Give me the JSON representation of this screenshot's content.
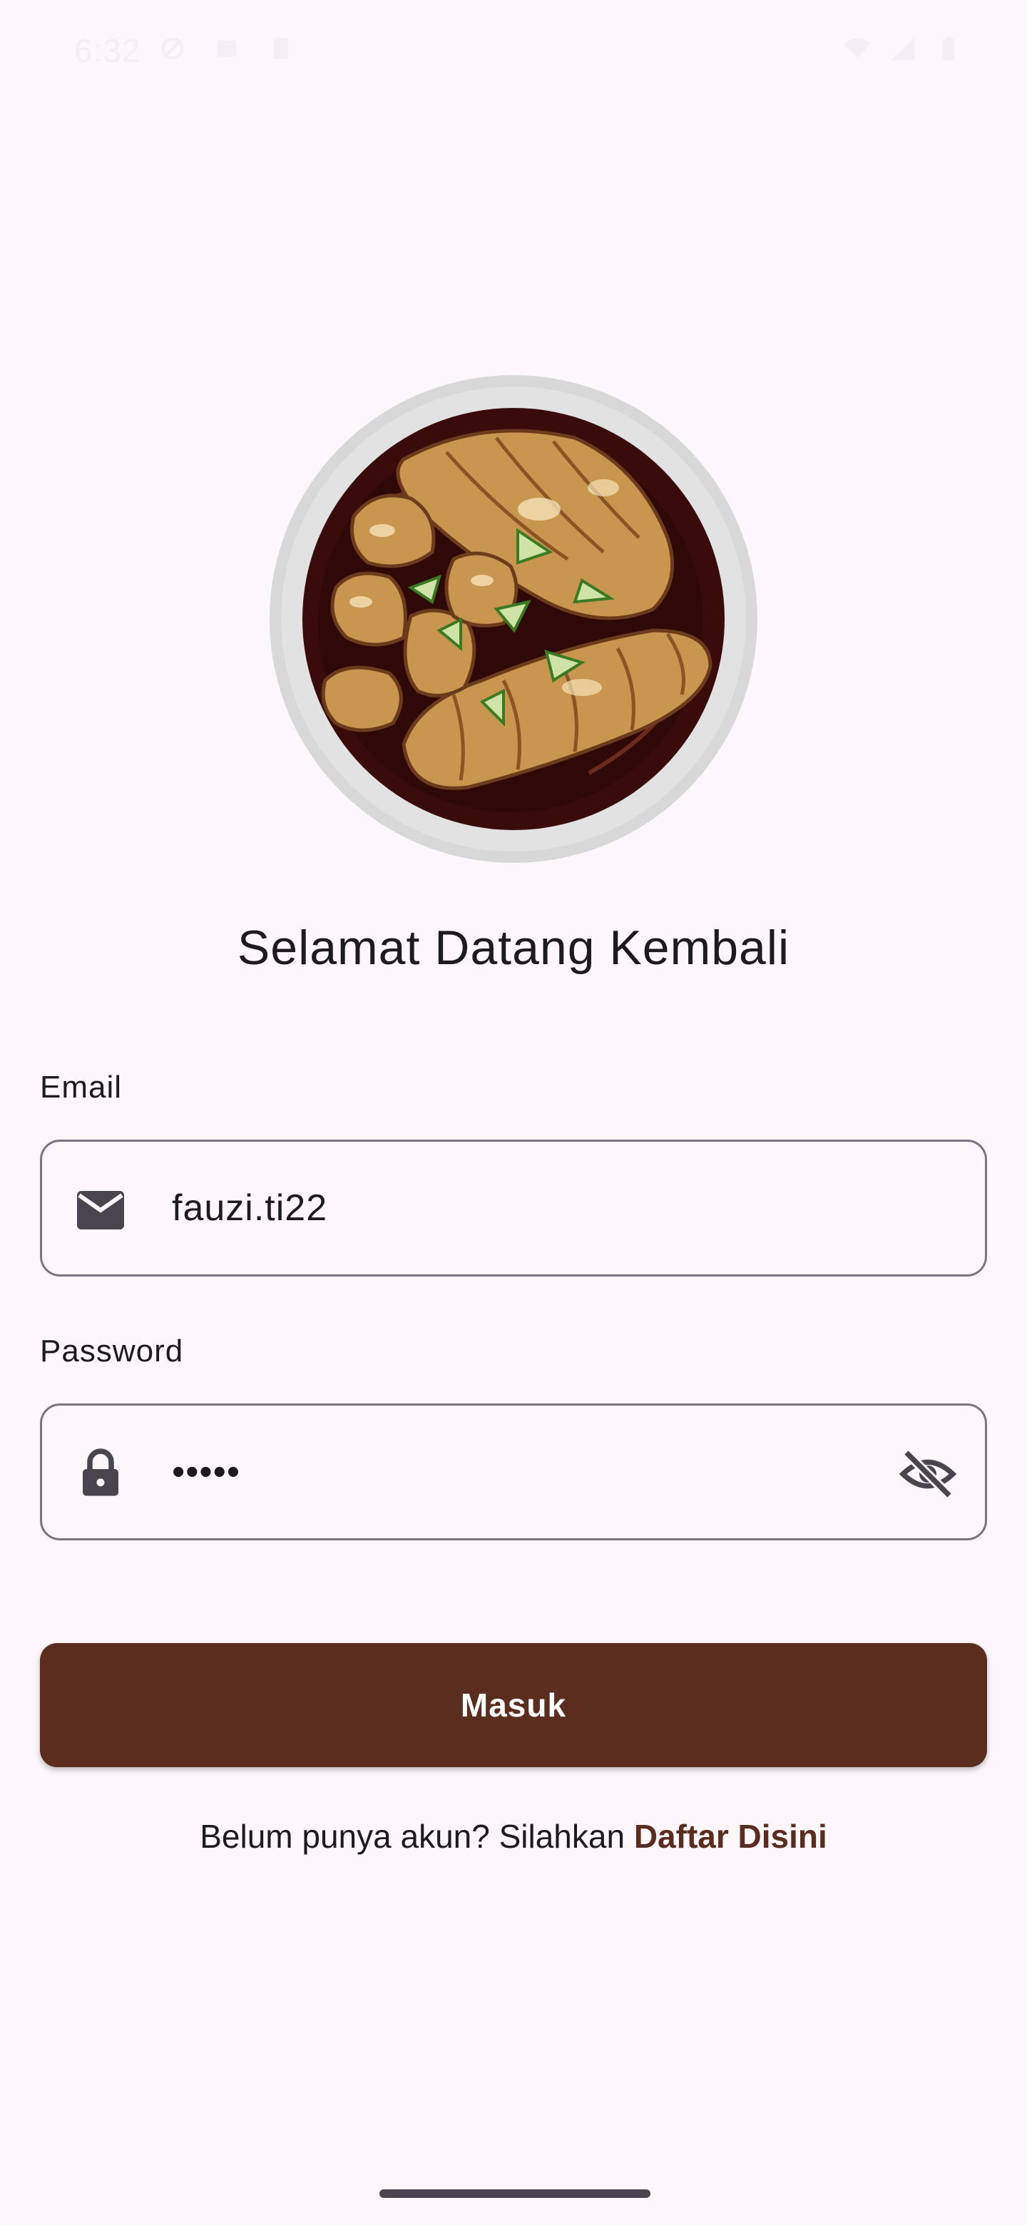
{
  "status_bar": {
    "time": "6:32",
    "icons_left": [
      "data-saver-icon",
      "notification-icon",
      "sd-card-icon"
    ],
    "icons_right": [
      "wifi-icon",
      "signal-icon",
      "battery-icon"
    ]
  },
  "hero": {
    "image": "bakso-bowl-illustration"
  },
  "welcome_title": "Selamat Datang Kembali",
  "form": {
    "email": {
      "label": "Email",
      "value": "fauzi.ti22",
      "icon": "mail-icon"
    },
    "password": {
      "label": "Password",
      "value": "•••••",
      "icon": "lock-icon",
      "toggle_icon": "visibility-off-icon"
    },
    "submit_label": "Masuk"
  },
  "register": {
    "prompt": "Belum punya akun? Silahkan ",
    "link_label": "Daftar Disini"
  },
  "colors": {
    "background": "#fdf7fb",
    "primary": "#5a2d1f",
    "outline": "#79747e"
  }
}
